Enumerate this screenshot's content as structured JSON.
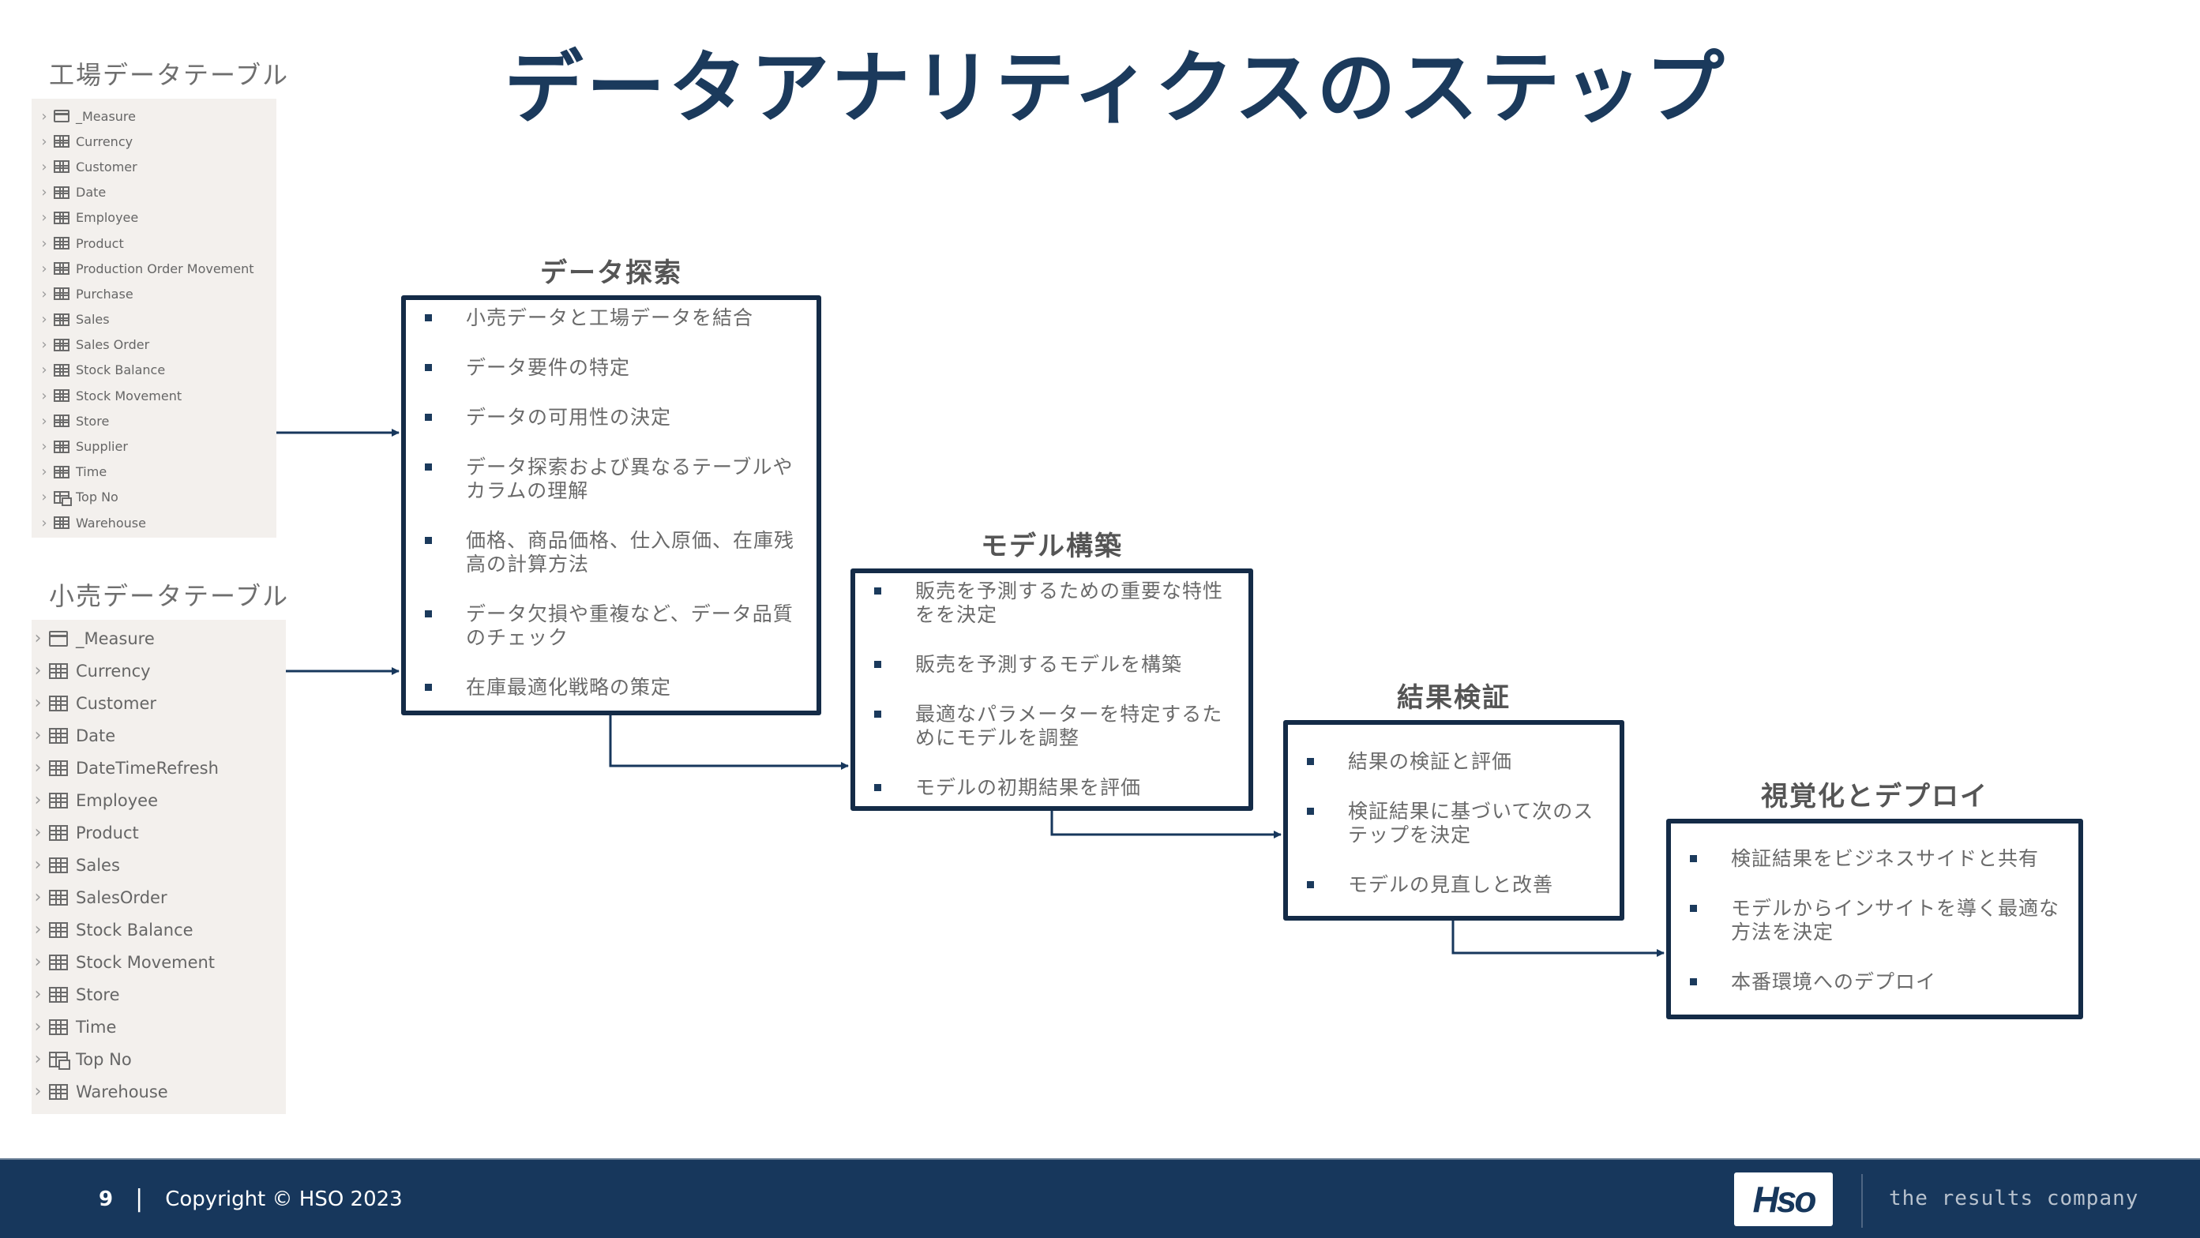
{
  "title": "データアナリティクスのステップ",
  "factory_tables": {
    "heading": "工場データテーブル",
    "items": [
      {
        "name": "_Measure",
        "icon": "measure-table-icon"
      },
      {
        "name": "Currency",
        "icon": "table-icon"
      },
      {
        "name": "Customer",
        "icon": "table-icon"
      },
      {
        "name": "Date",
        "icon": "table-icon"
      },
      {
        "name": "Employee",
        "icon": "table-icon"
      },
      {
        "name": "Product",
        "icon": "table-icon"
      },
      {
        "name": "Production Order Movement",
        "icon": "table-icon"
      },
      {
        "name": "Purchase",
        "icon": "table-icon"
      },
      {
        "name": "Sales",
        "icon": "table-icon"
      },
      {
        "name": "Sales Order",
        "icon": "table-icon"
      },
      {
        "name": "Stock Balance",
        "icon": "table-icon"
      },
      {
        "name": "Stock Movement",
        "icon": "table-icon"
      },
      {
        "name": "Store",
        "icon": "table-icon"
      },
      {
        "name": "Supplier",
        "icon": "table-icon"
      },
      {
        "name": "Time",
        "icon": "table-icon"
      },
      {
        "name": "Top No",
        "icon": "calculated-table-icon"
      },
      {
        "name": "Warehouse",
        "icon": "table-icon"
      }
    ]
  },
  "retail_tables": {
    "heading": "小売データテーブル",
    "items": [
      {
        "name": "_Measure",
        "icon": "measure-table-icon"
      },
      {
        "name": "Currency",
        "icon": "table-icon"
      },
      {
        "name": "Customer",
        "icon": "table-icon"
      },
      {
        "name": "Date",
        "icon": "table-icon"
      },
      {
        "name": "DateTimeRefresh",
        "icon": "table-icon"
      },
      {
        "name": "Employee",
        "icon": "table-icon"
      },
      {
        "name": "Product",
        "icon": "table-icon"
      },
      {
        "name": "Sales",
        "icon": "table-icon"
      },
      {
        "name": "SalesOrder",
        "icon": "table-icon"
      },
      {
        "name": "Stock Balance",
        "icon": "table-icon"
      },
      {
        "name": "Stock Movement",
        "icon": "table-icon"
      },
      {
        "name": "Store",
        "icon": "table-icon"
      },
      {
        "name": "Time",
        "icon": "table-icon"
      },
      {
        "name": "Top No",
        "icon": "calculated-table-icon"
      },
      {
        "name": "Warehouse",
        "icon": "table-icon"
      }
    ]
  },
  "steps": [
    {
      "title": "データ探索",
      "bullets": [
        "小売データと工場データを結合",
        "データ要件の特定",
        "データの可用性の決定",
        "データ探索および異なるテーブルやカラムの理解",
        "価格、商品価格、仕入原価、在庫残高の計算方法",
        "データ欠損や重複など、データ品質のチェック",
        "在庫最適化戦略の策定"
      ]
    },
    {
      "title": "モデル構築",
      "bullets": [
        "販売を予測するための重要な特性をを決定",
        "販売を予測するモデルを構築",
        "最適なパラメーターを特定するためにモデルを調整",
        "モデルの初期結果を評価"
      ]
    },
    {
      "title": "結果検証",
      "bullets": [
        "結果の検証と評価",
        "検証結果に基づいて次のステップを決定",
        "モデルの見直しと改善"
      ]
    },
    {
      "title": "視覚化とデプロイ",
      "bullets": [
        "検証結果をビジネスサイドと共有",
        "モデルからインサイトを導く最適な方法を決定",
        "本番環境へのデプロイ"
      ]
    }
  ],
  "footer": {
    "page_number": "9",
    "separator": "|",
    "copyright": "Copyright © HSO 2023",
    "logo_text": "Hso",
    "tagline": "the results company"
  },
  "colors": {
    "accent": "#1b3a5c",
    "box_border": "#142b47",
    "footer_bg": "#17375c",
    "body_text": "#6a6a6a",
    "panel_bg": "#f3f0ed"
  }
}
